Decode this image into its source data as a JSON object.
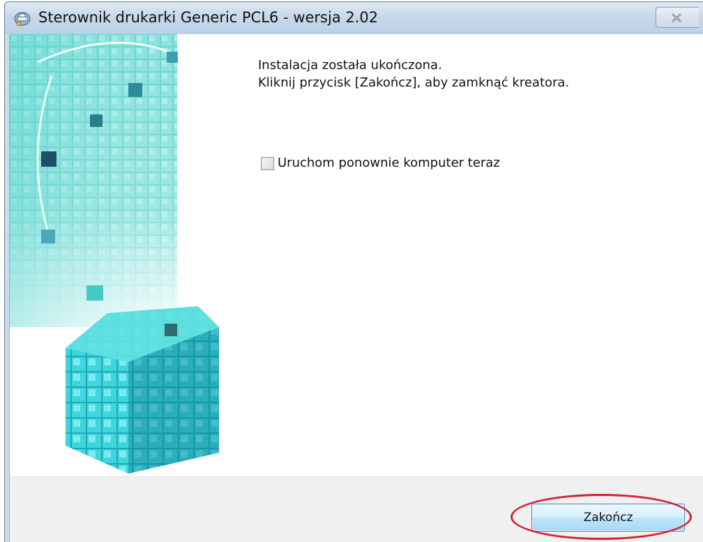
{
  "window": {
    "title": "Sterownik drukarki Generic PCL6 - wersja 2.02",
    "icon": "printer-driver-icon",
    "close_icon": "close-icon"
  },
  "content": {
    "line1": "Instalacja została ukończona.",
    "line2": "Kliknij przycisk [Zakończ], aby zamknąć kreatora."
  },
  "restart_option": {
    "label": "Uruchom ponownie komputer teraz",
    "checked": false
  },
  "footer": {
    "finish_label": "Zakończ"
  },
  "colors": {
    "accent_cube": "#35d3d6",
    "annotation": "#d0243a",
    "button_border": "#3c7fb1"
  }
}
